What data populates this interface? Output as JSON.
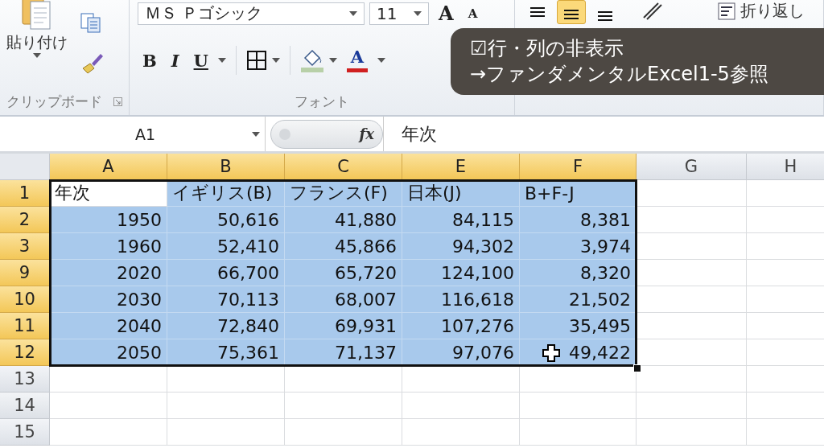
{
  "ribbon": {
    "clipboard": {
      "paste_label": "貼り付け",
      "group_label": "クリップボード"
    },
    "font": {
      "font_name": "ＭＳ Ｐゴシック",
      "font_size": "11",
      "grow_glyph": "A",
      "shrink_glyph": "A",
      "bold_glyph": "B",
      "italic_glyph": "I",
      "underline_glyph": "U",
      "color_glyph": "A",
      "group_label": "フォント"
    },
    "alignment": {
      "align_buttons": [
        {
          "kind": "top",
          "selected": false
        },
        {
          "kind": "middle",
          "selected": true
        },
        {
          "kind": "bottom",
          "selected": false
        }
      ],
      "wrap_label": "折り返し"
    }
  },
  "caption": {
    "lines": [
      "☑行・列の非表示",
      "→ファンダメンタルExcel1-5参照"
    ]
  },
  "formula_bar": {
    "name_box": "A1",
    "fx_label": "fx",
    "content": "年次"
  },
  "sheet": {
    "columns": [
      {
        "label": "A",
        "selected": true
      },
      {
        "label": "B",
        "selected": true
      },
      {
        "label": "C",
        "selected": true
      },
      {
        "label": "E",
        "selected": true
      },
      {
        "label": "F",
        "selected": true
      },
      {
        "label": "G",
        "selected": false
      },
      {
        "label": "H",
        "selected": false
      }
    ],
    "rows": [
      {
        "header": "1",
        "selected": true,
        "kind": "labels",
        "cells": [
          {
            "text": "年次",
            "selected": false
          },
          {
            "text": "イギリス(B)",
            "selected": true
          },
          {
            "text": "フランス(F)",
            "selected": true
          },
          {
            "text": "日本(J)",
            "selected": true
          },
          {
            "text": "B+F-J",
            "selected": true
          }
        ]
      },
      {
        "header": "2",
        "selected": true,
        "kind": "values",
        "cells": [
          {
            "text": "1950",
            "selected": true
          },
          {
            "text": "50,616",
            "selected": true
          },
          {
            "text": "41,880",
            "selected": true
          },
          {
            "text": "84,115",
            "selected": true
          },
          {
            "text": "8,381",
            "selected": true
          }
        ]
      },
      {
        "header": "3",
        "selected": true,
        "kind": "values",
        "cells": [
          {
            "text": "1960",
            "selected": true
          },
          {
            "text": "52,410",
            "selected": true
          },
          {
            "text": "45,866",
            "selected": true
          },
          {
            "text": "94,302",
            "selected": true
          },
          {
            "text": "3,974",
            "selected": true
          }
        ]
      },
      {
        "header": "9",
        "selected": true,
        "kind": "values",
        "cells": [
          {
            "text": "2020",
            "selected": true
          },
          {
            "text": "66,700",
            "selected": true
          },
          {
            "text": "65,720",
            "selected": true
          },
          {
            "text": "124,100",
            "selected": true
          },
          {
            "text": "8,320",
            "selected": true
          }
        ]
      },
      {
        "header": "10",
        "selected": true,
        "kind": "values",
        "cells": [
          {
            "text": "2030",
            "selected": true
          },
          {
            "text": "70,113",
            "selected": true
          },
          {
            "text": "68,007",
            "selected": true
          },
          {
            "text": "116,618",
            "selected": true
          },
          {
            "text": "21,502",
            "selected": true
          }
        ]
      },
      {
        "header": "11",
        "selected": true,
        "kind": "values",
        "cells": [
          {
            "text": "2040",
            "selected": true
          },
          {
            "text": "72,840",
            "selected": true
          },
          {
            "text": "69,931",
            "selected": true
          },
          {
            "text": "107,276",
            "selected": true
          },
          {
            "text": "35,495",
            "selected": true
          }
        ]
      },
      {
        "header": "12",
        "selected": true,
        "kind": "values",
        "cells": [
          {
            "text": "2050",
            "selected": true
          },
          {
            "text": "75,361",
            "selected": true
          },
          {
            "text": "71,137",
            "selected": true
          },
          {
            "text": "97,076",
            "selected": true
          },
          {
            "text": "49,422",
            "selected": true
          }
        ]
      },
      {
        "header": "13",
        "selected": false,
        "kind": "empty",
        "cells": []
      },
      {
        "header": "14",
        "selected": false,
        "kind": "empty",
        "cells": []
      },
      {
        "header": "15",
        "selected": false,
        "kind": "empty",
        "cells": []
      }
    ]
  }
}
